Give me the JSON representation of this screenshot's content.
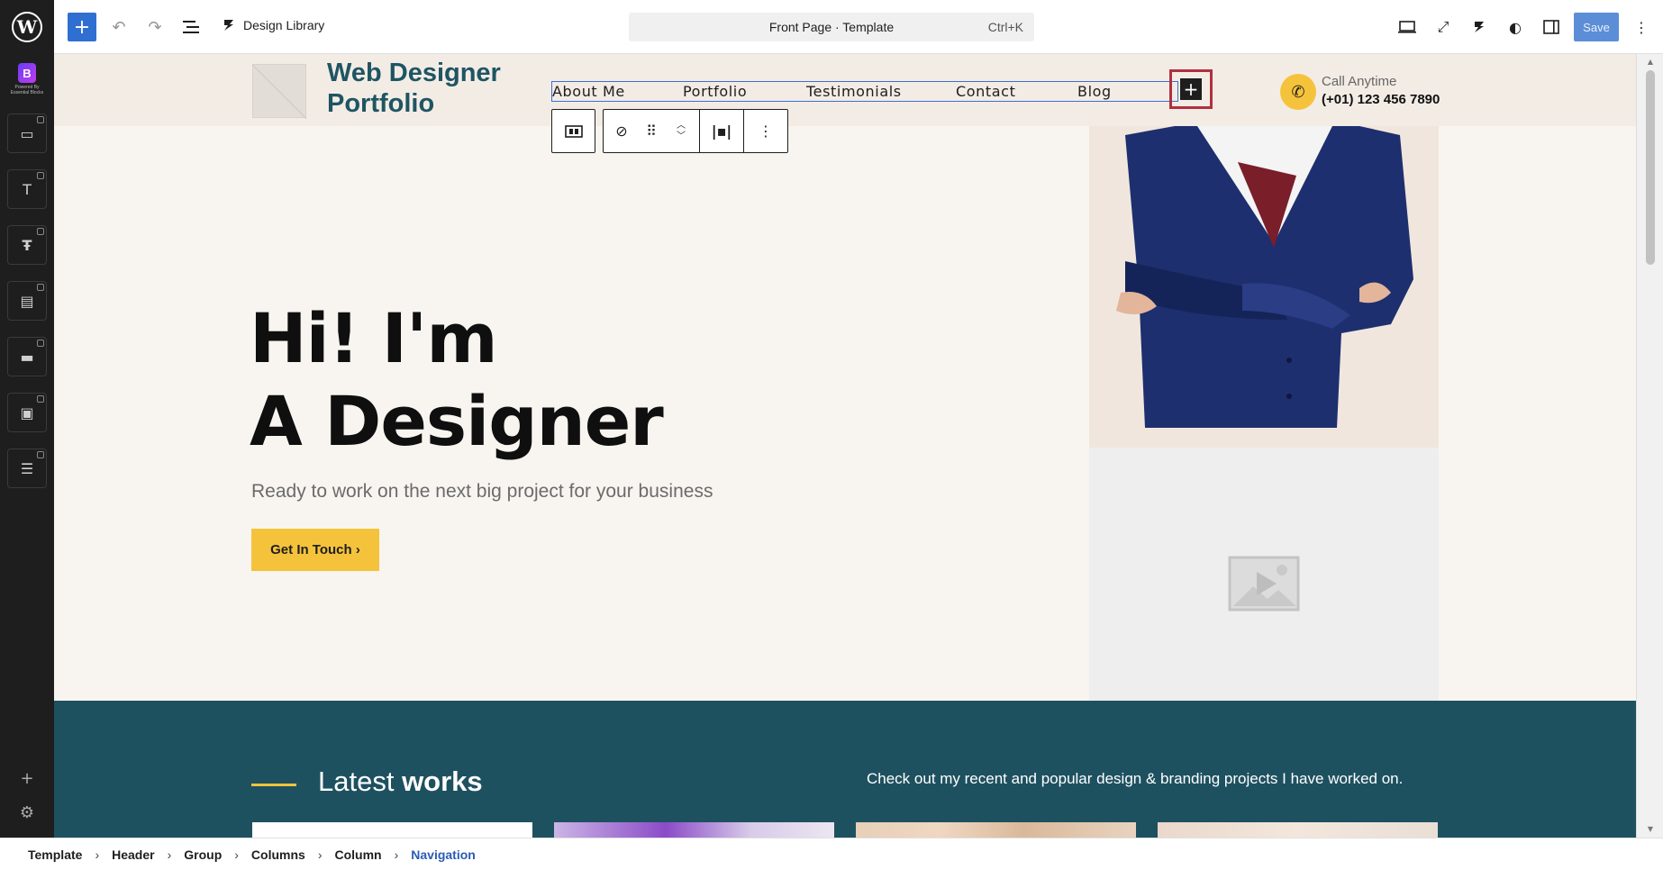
{
  "toolbar": {
    "design_library": "Design Library",
    "command": {
      "title": "Front Page · Template",
      "shortcut": "Ctrl+K"
    },
    "save_label": "Save",
    "icons": [
      "wordpress-icon",
      "plus-icon",
      "undo-icon",
      "redo-icon",
      "list-view-icon",
      "stackable-icon",
      "desktop-icon",
      "fullscreen-icon",
      "stackable-settings-icon",
      "contrast-icon",
      "sidebar-icon",
      "more-icon"
    ]
  },
  "sidebar": {
    "brand": {
      "powered_by": "Powered By Essential Blocks"
    },
    "items": [
      "blocks-icon",
      "text-icon",
      "typography-icon",
      "card-icon",
      "button-icon",
      "image-icon",
      "form-icon"
    ]
  },
  "site": {
    "title": "Web Designer Portfolio",
    "nav": [
      "About Me",
      "Portfolio",
      "Testimonials",
      "Contact",
      "Blog"
    ],
    "call_label": "Call Anytime",
    "call_number": "(+01) 123 456 7890"
  },
  "hero": {
    "line1": "Hi! I'm",
    "line2": "A Designer",
    "subtitle": "Ready to work on the next big project for your business",
    "cta": "Get In Touch ›"
  },
  "works": {
    "title_light": "Latest ",
    "title_bold": "works",
    "description": "Check out my recent and popular design & branding projects I have worked on."
  },
  "breadcrumb": [
    "Template",
    "Header",
    "Group",
    "Columns",
    "Column",
    "Navigation"
  ],
  "colors": {
    "accent": "#f5c33b",
    "brand": "#1e5563",
    "teal": "#1e5160",
    "wp_blue": "#2f6fd1",
    "highlight": "#b0303f"
  }
}
